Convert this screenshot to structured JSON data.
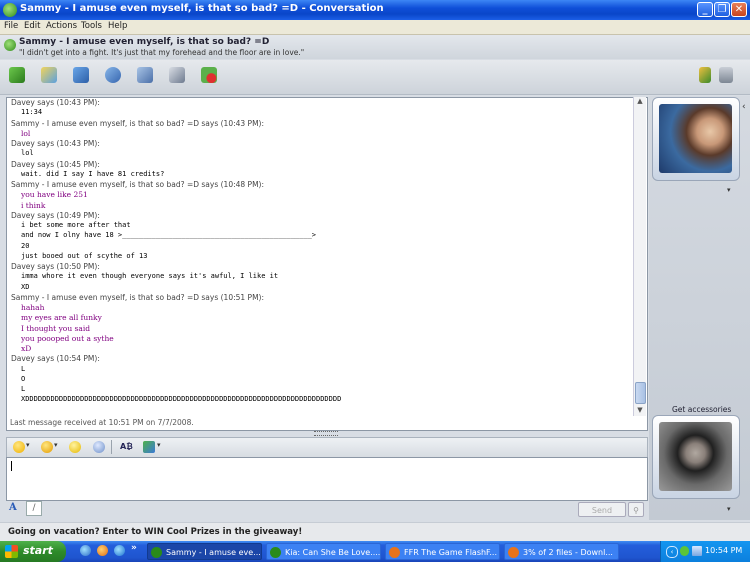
{
  "window": {
    "title": "Sammy - I amuse even myself, is that so bad? =D - Conversation",
    "buttons": [
      "_",
      "❐",
      "✕"
    ]
  },
  "menu": [
    "File",
    "Edit",
    "Actions",
    "Tools",
    "Help"
  ],
  "contact": {
    "name": "Sammy - I amuse even myself, is that so bad? =D",
    "status": "\"I didn't get into a fight.  It's just that my forehead and the floor are in love.\""
  },
  "messages": [
    {
      "t": "sender",
      "text": "Davey says (10:43 PM):"
    },
    {
      "t": "msg",
      "text": "11:34"
    },
    {
      "t": "sender",
      "text": "Sammy - I amuse even myself, is that so bad? =D says (10:43 PM):"
    },
    {
      "t": "msgp",
      "text": "lol"
    },
    {
      "t": "sender",
      "text": "Davey says (10:43 PM):"
    },
    {
      "t": "msg",
      "text": "lol"
    },
    {
      "t": "sender",
      "text": "Davey says (10:45 PM):"
    },
    {
      "t": "msg",
      "text": "wait. did I say I have 81 credits?"
    },
    {
      "t": "sender",
      "text": "Sammy - I amuse even myself, is that so bad? =D says (10:48 PM):"
    },
    {
      "t": "msgp",
      "text": "you have like 251"
    },
    {
      "t": "msgp",
      "text": "i think"
    },
    {
      "t": "sender",
      "text": "Davey says (10:49 PM):"
    },
    {
      "t": "msg",
      "text": "i bet some more after that"
    },
    {
      "t": "msg",
      "text": "and now I olny have 18 >_____________________________________________>"
    },
    {
      "t": "msg",
      "text": "20"
    },
    {
      "t": "msg",
      "text": "just booed out of scythe of 13"
    },
    {
      "t": "sender",
      "text": "Davey says (10:50 PM):"
    },
    {
      "t": "msg",
      "text": "imma whore it even though everyone says it's awful, I like it"
    },
    {
      "t": "msg",
      "text": "XD"
    },
    {
      "t": "sender",
      "text": "Sammy - I amuse even myself, is that so bad? =D says (10:51 PM):"
    },
    {
      "t": "msgp",
      "text": "hahah"
    },
    {
      "t": "msgp",
      "text": "my eyes are all funky"
    },
    {
      "t": "msgp",
      "text": "I thought you said"
    },
    {
      "t": "msgp",
      "text": "you poooped out a sythe"
    },
    {
      "t": "msgp",
      "text": "xD"
    },
    {
      "t": "sender",
      "text": "Davey says (10:54 PM):"
    },
    {
      "t": "msg",
      "text": "L"
    },
    {
      "t": "msg",
      "text": "O"
    },
    {
      "t": "msg",
      "text": "L"
    },
    {
      "t": "msg",
      "text": "XDDDDDDDDDDDDDDDDDDDDDDDDDDDDDDDDDDDDDDDDDDDDDDDDDDDDDDDDDDDDDDDDDDDDDDDDDDD"
    }
  ],
  "last_message": "Last message received at 10:51 PM on 7/7/2008.",
  "input": {
    "value": ""
  },
  "send_label": "Send",
  "accessories_label": "Get accessories",
  "promo": "Going on vacation? Enter to WIN Cool Prizes in the giveaway!",
  "taskbar": {
    "start": "start",
    "tasks": [
      {
        "label": "Sammy - I amuse eve...",
        "color": "#2a8b1a",
        "active": true
      },
      {
        "label": "Kia: Can She Be Love....",
        "color": "#2a8b1a",
        "active": false
      },
      {
        "label": "FFR The Game FlashF...",
        "color": "#e8731a",
        "active": false
      },
      {
        "label": "3% of 2 files - Downl...",
        "color": "#e8731a",
        "active": false
      }
    ],
    "clock": "10:54 PM"
  }
}
